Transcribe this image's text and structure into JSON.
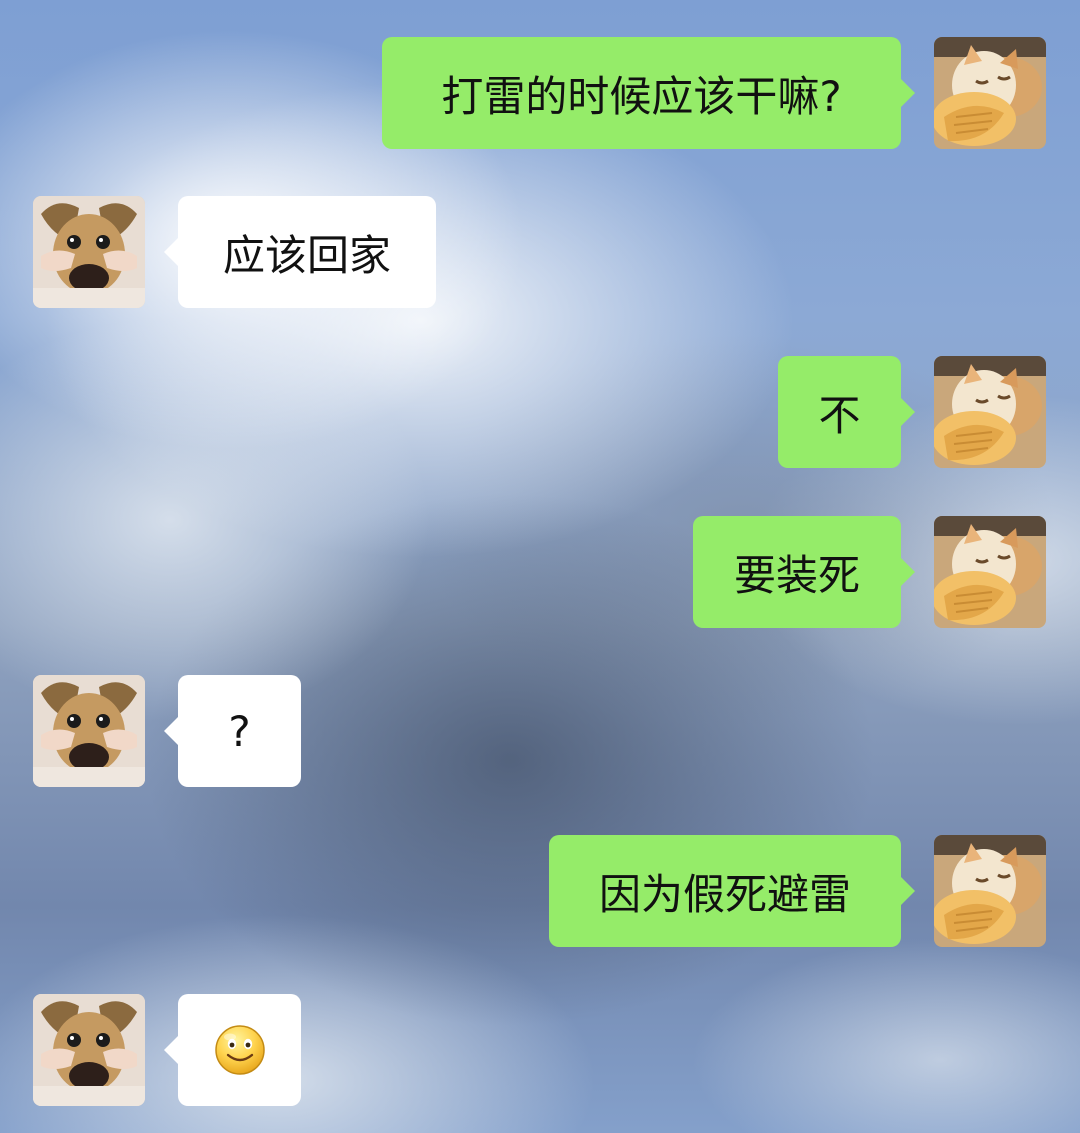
{
  "messages": [
    {
      "sender": "me",
      "text": "打雷的时候应该干嘛?"
    },
    {
      "sender": "other",
      "text": "应该回家"
    },
    {
      "sender": "me",
      "text": "不"
    },
    {
      "sender": "me",
      "text": "要装死"
    },
    {
      "sender": "other",
      "text": "?"
    },
    {
      "sender": "me",
      "text": "因为假死避雷"
    },
    {
      "sender": "other",
      "emoji": "smile-icon"
    }
  ],
  "colors": {
    "sent_bubble": "#95ec69",
    "received_bubble": "#ffffff"
  },
  "avatars": {
    "me": "cat-avatar",
    "other": "dog-avatar"
  }
}
